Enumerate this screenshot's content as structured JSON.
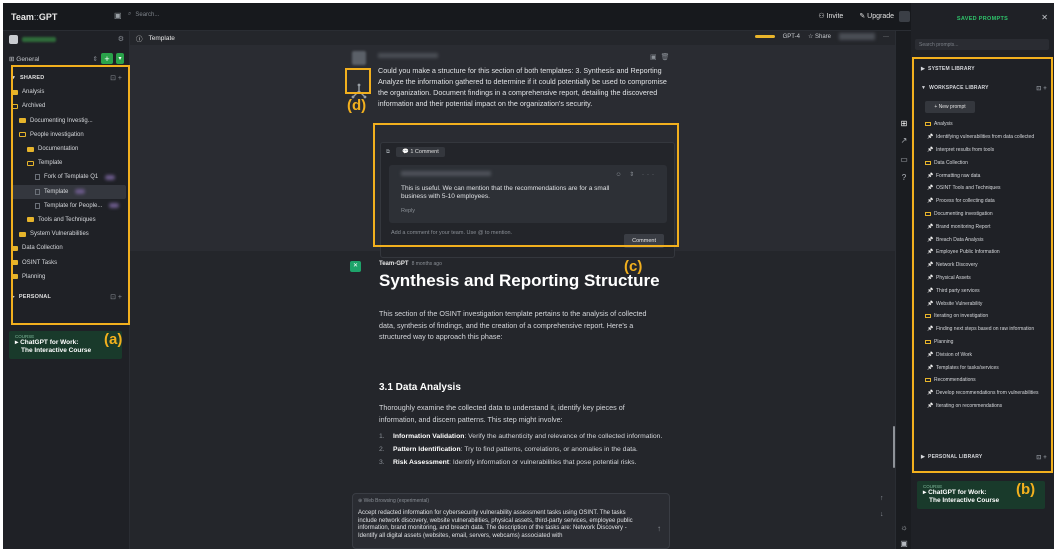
{
  "app": {
    "brand_left": "Team",
    "brand_sep": "::",
    "brand_right": "GPT"
  },
  "topbar": {
    "search_placeholder": "Search...",
    "invite": "Invite",
    "upgrade": "Upgrade"
  },
  "left": {
    "general": "General",
    "shared_label": "SHARED",
    "personal_label": "PERSONAL",
    "tree": [
      {
        "label": "Analysis",
        "depth": 0,
        "kind": "folder"
      },
      {
        "label": "Archived",
        "depth": 0,
        "kind": "folder-open"
      },
      {
        "label": "Documenting Investig...",
        "depth": 1,
        "kind": "folder"
      },
      {
        "label": "People investigation",
        "depth": 1,
        "kind": "folder-open"
      },
      {
        "label": "Documentation",
        "depth": 2,
        "kind": "folder"
      },
      {
        "label": "Template",
        "depth": 2,
        "kind": "folder-open"
      },
      {
        "label": "Fork of Template Q1",
        "depth": 3,
        "kind": "doc",
        "blur": true
      },
      {
        "label": "Template",
        "depth": 3,
        "kind": "doc",
        "selected": true,
        "blur": true
      },
      {
        "label": "Template for People...",
        "depth": 3,
        "kind": "doc",
        "blur": true
      },
      {
        "label": "Tools and Techniques",
        "depth": 2,
        "kind": "folder"
      },
      {
        "label": "System Vulnerabilities",
        "depth": 1,
        "kind": "folder"
      },
      {
        "label": "Data Collection",
        "depth": 0,
        "kind": "folder"
      },
      {
        "label": "OSINT Tasks",
        "depth": 0,
        "kind": "folder"
      },
      {
        "label": "Planning",
        "depth": 0,
        "kind": "folder"
      }
    ],
    "course": {
      "small": "COURSE",
      "line1": "ChatGPT for Work:",
      "line2": "The Interactive Course"
    }
  },
  "main": {
    "breadcrumb": "Template",
    "model": "GPT-4",
    "share": "Share",
    "user_message": "Could you make a structure for this section of both templates: 3. Synthesis and Reporting\nAnalyze the information gathered to determine if it could potentially be used to compromise the organization. Document findings in a comprehensive report, detailing the discovered information and their potential impact on the organization's security.",
    "comments": {
      "count_label": "1 Comment",
      "text": "This is useful. We can mention that the recommendations are for a small business with 5-10 employees.",
      "reply": "Reply",
      "input_placeholder": "Add a comment for your team. Use @ to mention.",
      "button": "Comment"
    },
    "assistant": {
      "name": "Team-GPT",
      "time": "8 months ago",
      "title": "Synthesis and Reporting Structure",
      "intro": "This section of the OSINT investigation template pertains to the analysis of collected data, synthesis of findings, and the creation of a comprehensive report. Here's a structured way to approach this phase:",
      "h3": "3.1 Data Analysis",
      "h3_text": "Thoroughly examine the collected data to understand it, identify key pieces of information, and discern patterns. This step might involve:",
      "list": [
        {
          "num": "1.",
          "bold": "Information Validation",
          "rest": ": Verify the authenticity and relevance of the collected information."
        },
        {
          "num": "2.",
          "bold": "Pattern Identification",
          "rest": ": Try to find patterns, correlations, or anomalies in the data."
        },
        {
          "num": "3.",
          "bold": "Risk Assessment",
          "rest": ": Identify information or vulnerabilities that pose potential risks."
        }
      ]
    },
    "composer": {
      "mode": "Web Browsing (experimental)",
      "text": "Accept redacted information for cybersecurity vulnerability assessment tasks using OSINT.  The tasks include network discovery, website vulnerabilities, physical assets, third-party services, employee public information, brand monitoring, and breach data. The description of the tasks are: Network Discovery - Identify all digital assets (websites, email, servers, webcams) associated with"
    }
  },
  "right": {
    "title": "SAVED PROMPTS",
    "search_placeholder": "Search prompts...",
    "system_library": "SYSTEM LIBRARY",
    "workspace_library": "WORKSPACE LIBRARY",
    "personal_library": "PERSONAL LIBRARY",
    "new_prompt": "+ New prompt",
    "items": [
      {
        "label": "Analysis",
        "kind": "folder"
      },
      {
        "label": "Identifying vulnerabilities from data collected",
        "kind": "pin"
      },
      {
        "label": "Interpret results from tools",
        "kind": "pin"
      },
      {
        "label": "Data Collection",
        "kind": "folder"
      },
      {
        "label": "Formatting raw data",
        "kind": "pin"
      },
      {
        "label": "OSINT Tools and Techniques",
        "kind": "pin"
      },
      {
        "label": "Process for collecting data",
        "kind": "pin"
      },
      {
        "label": "Documenting investigation",
        "kind": "folder"
      },
      {
        "label": "Brand monitoring Report",
        "kind": "pin"
      },
      {
        "label": "Breach Data Analysis",
        "kind": "pin"
      },
      {
        "label": "Employee Public Information",
        "kind": "pin"
      },
      {
        "label": "Network Discovery",
        "kind": "pin"
      },
      {
        "label": "Physical Assets",
        "kind": "pin"
      },
      {
        "label": "Third party services",
        "kind": "pin"
      },
      {
        "label": "Website Vulnerability",
        "kind": "pin"
      },
      {
        "label": "Iterating on investigation",
        "kind": "folder"
      },
      {
        "label": "Finding next steps based on raw information",
        "kind": "pin"
      },
      {
        "label": "Planning",
        "kind": "folder"
      },
      {
        "label": "Division of Work",
        "kind": "pin"
      },
      {
        "label": "Templates for tasks/services",
        "kind": "pin"
      },
      {
        "label": "Recommendations",
        "kind": "folder"
      },
      {
        "label": "Develop recommendations from vulnerabilities",
        "kind": "pin"
      },
      {
        "label": "Iterating on recommendations",
        "kind": "pin"
      }
    ],
    "course": {
      "small": "COURSE",
      "line1": "ChatGPT for Work:",
      "line2": "The Interactive Course"
    }
  },
  "annotations": {
    "a": "(a)",
    "b": "(b)",
    "c": "(c)",
    "d": "(d)"
  },
  "colors": {
    "highlight": "#f2b01e",
    "brand_green": "#2aa34a",
    "folder": "#e6b42b"
  }
}
